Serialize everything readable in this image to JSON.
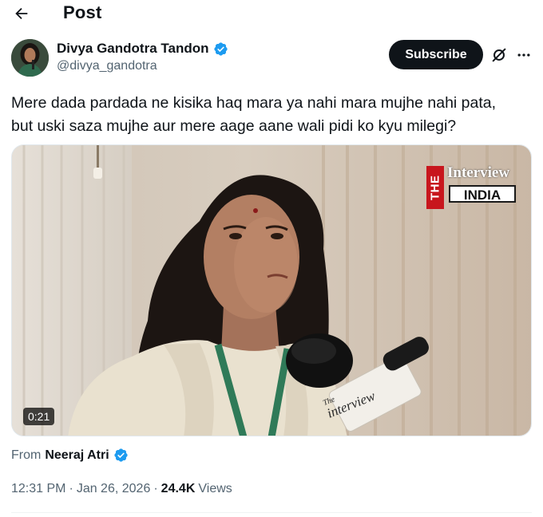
{
  "header": {
    "title": "Post",
    "back_icon": "arrow-left-icon"
  },
  "author": {
    "display_name": "Divya Gandotra Tandon",
    "handle": "@divya_gandotra",
    "verified": true,
    "verified_color": "#1d9bf0"
  },
  "actions": {
    "subscribe_label": "Subscribe",
    "grok_icon": "grok-icon",
    "more_icon": "more-horizontal-icon"
  },
  "tweet": {
    "text_line1": "Mere dada pardada ne kisika haq mara ya nahi mara mujhe nahi pata,",
    "text_line2": "but uski saza mujhe aur mere aage aane wali pidi ko kyu milegi?"
  },
  "media": {
    "duration": "0:21",
    "watermark": {
      "the": "THE",
      "interview": "Interview",
      "india": "INDIA"
    },
    "mic_label": {
      "the": "The",
      "interview": "interview"
    }
  },
  "source": {
    "from_label": "From",
    "from_name": "Neeraj Atri",
    "verified": true
  },
  "meta": {
    "time": "12:31 PM",
    "separator": "·",
    "date": "Jan 26, 2026",
    "views_count": "24.4K",
    "views_label": "Views"
  },
  "colors": {
    "text_primary": "#0f1419",
    "text_secondary": "#536471",
    "accent": "#1d9bf0",
    "button_dark": "#0f1419"
  }
}
